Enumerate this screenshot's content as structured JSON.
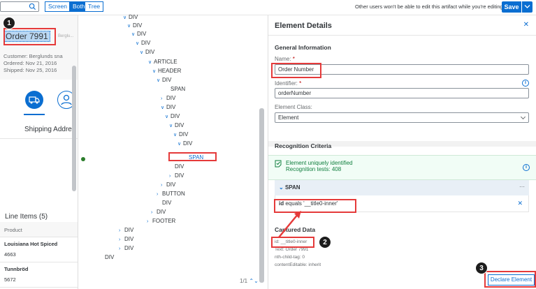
{
  "toolbar": {
    "segments": [
      "Screen",
      "Both",
      "Tree"
    ],
    "notice": "Other users won't be able to edit this artifact while you're editing it.",
    "save_label": "Save"
  },
  "app": {
    "order_title": "Order 7991",
    "order_sub": "Berglu...",
    "customer": "Customer: Berglunds sna",
    "ordered": "Ordered: Nov 21, 2016",
    "shipped": "Shipped: Nov 25, 2016",
    "shipping_address": "Shipping Addre",
    "line_items": "Line Items (5)",
    "col_product": "Product",
    "rows": [
      {
        "name": "Louisiana Hot Spiced",
        "id": "4663"
      },
      {
        "name": "Tunnbröd",
        "id": "5672"
      }
    ]
  },
  "tree": {
    "nodes": [
      {
        "label": "DIV",
        "chev": "v"
      },
      {
        "label": "DIV",
        "chev": "v"
      },
      {
        "label": "DIV",
        "chev": "v"
      },
      {
        "label": "DIV",
        "chev": "v"
      },
      {
        "label": "DIV",
        "chev": "v"
      },
      {
        "label": "ARTICLE",
        "chev": "v"
      },
      {
        "label": "HEADER",
        "chev": "v"
      },
      {
        "label": "DIV",
        "chev": "v"
      },
      {
        "label": "SPAN",
        "chev": ""
      },
      {
        "label": "DIV",
        "chev": ">"
      },
      {
        "label": "DIV",
        "chev": "v"
      },
      {
        "label": "DIV",
        "chev": "v"
      },
      {
        "label": "DIV",
        "chev": "v"
      },
      {
        "label": "DIV",
        "chev": "v"
      },
      {
        "label": "DIV",
        "chev": "v"
      },
      {
        "label": "SPAN",
        "chev": ""
      },
      {
        "label": "DIV",
        "chev": ""
      },
      {
        "label": "DIV",
        "chev": ">"
      },
      {
        "label": "DIV",
        "chev": ">"
      },
      {
        "label": "BUTTON",
        "chev": ">"
      },
      {
        "label": "DIV",
        "chev": ""
      },
      {
        "label": "DIV",
        "chev": ">"
      },
      {
        "label": "FOOTER",
        "chev": ">"
      },
      {
        "label": "DIV",
        "chev": ">"
      },
      {
        "label": "DIV",
        "chev": ">"
      },
      {
        "label": "DIV",
        "chev": ">"
      },
      {
        "label": "DIV",
        "chev": ""
      }
    ],
    "pager": "1/1"
  },
  "details": {
    "title": "Element Details",
    "general_info": "General Information",
    "name_label": "Name:",
    "name_value": "Order Number",
    "identifier_label": "Identifier:",
    "identifier_value": "orderNumber",
    "class_label": "Element Class:",
    "class_value": "Element",
    "recognition_title": "Recognition Criteria",
    "success_line1": "Element uniquely identified",
    "success_line2": "Recognition tests: 408",
    "span_label": "SPAN",
    "criteria_key": "id",
    "criteria_text": "equals '__title0-inner'",
    "captured_title": "Captured Data",
    "captured": [
      "id: __title0-inner",
      "Text: Order 7991",
      "nth-child-tag: 0",
      "contentEditable: inherit"
    ],
    "declare_label": "Declare Element"
  },
  "steps": [
    "1",
    "2",
    "3"
  ]
}
